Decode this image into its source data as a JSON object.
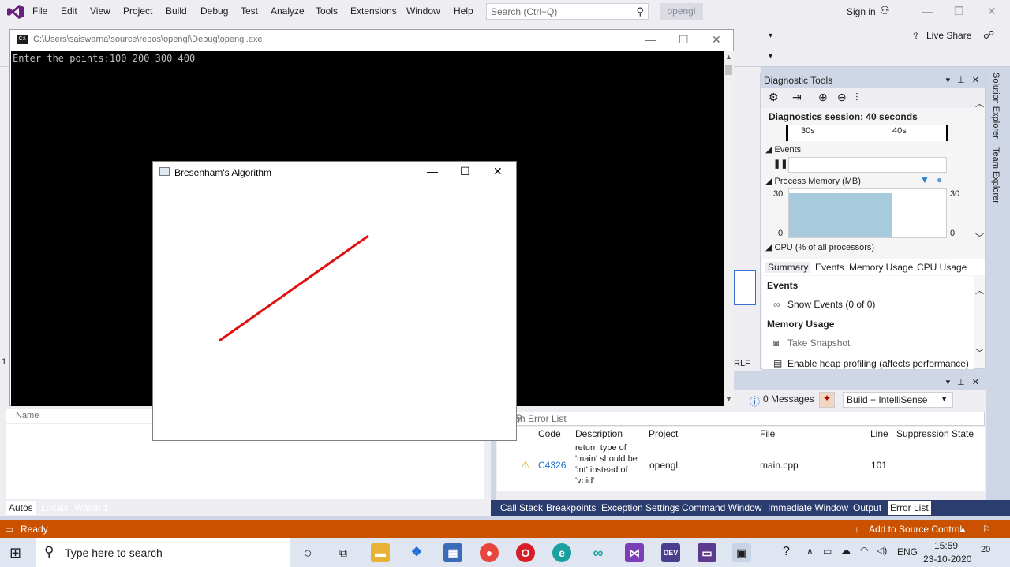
{
  "vs": {
    "menu": [
      "File",
      "Edit",
      "View",
      "Project",
      "Build",
      "Debug",
      "Test",
      "Analyze",
      "Tools",
      "Extensions",
      "Window",
      "Help"
    ],
    "search_placeholder": "Search (Ctrl+Q)",
    "solution_name": "opengl",
    "sign_in": "Sign in",
    "live_share": "Live Share"
  },
  "console": {
    "title": "C:\\Users\\saiswarna\\source\\repos\\opengl\\Debug\\opengl.exe",
    "output": "Enter the points:100 200 300 400"
  },
  "bresenham": {
    "title": "Bresenham's Algorithm",
    "line_color": "#e01010"
  },
  "diag": {
    "title": "Diagnostic Tools",
    "session": "Diagnostics session: 40 seconds",
    "tick1": "30s",
    "tick2": "40s",
    "events_label": "Events",
    "process_memory_label": "Process Memory (MB)",
    "mem_max_left": "30",
    "mem_max_right": "30",
    "mem_min_left": "0",
    "mem_min_right": "0",
    "cpu_label": "CPU (% of all processors)",
    "tabs": [
      "Summary",
      "Events",
      "Memory Usage",
      "CPU Usage"
    ],
    "events_section": "Events",
    "show_events": "Show Events (0 of 0)",
    "memory_section": "Memory Usage",
    "take_snapshot": "Take Snapshot",
    "heap_profiling": "Enable heap profiling (affects performance)"
  },
  "side_tabs": [
    "Solution Explorer",
    "Team Explorer"
  ],
  "autos": {
    "name_header": "Name",
    "tabs": [
      "Autos",
      "Locals",
      "Watch 1"
    ]
  },
  "errlist": {
    "messages": "0 Messages",
    "build_filter": "Build + IntelliSense",
    "search_placeholder": "ch Error List",
    "headers": [
      "Code",
      "Description",
      "Project",
      "File",
      "Line",
      "Suppression State"
    ],
    "row": {
      "code": "C4326",
      "description": [
        "return type of",
        "'main' should be",
        "'int' instead of",
        "'void'"
      ],
      "project": "opengl",
      "file": "main.cpp",
      "line": "101"
    },
    "tabs": [
      "Call Stack",
      "Breakpoints",
      "Exception Settings",
      "Command Window",
      "Immediate Window",
      "Output",
      "Error List"
    ]
  },
  "statusbar": {
    "ready": "Ready",
    "source_control": "Add to Source Control",
    "crlf": "RLF",
    "left_number": "1"
  },
  "taskbar": {
    "search_placeholder": "Type here to search",
    "language": "ENG",
    "time": "15:59",
    "date": "23-10-2020",
    "notification_count": "20"
  }
}
